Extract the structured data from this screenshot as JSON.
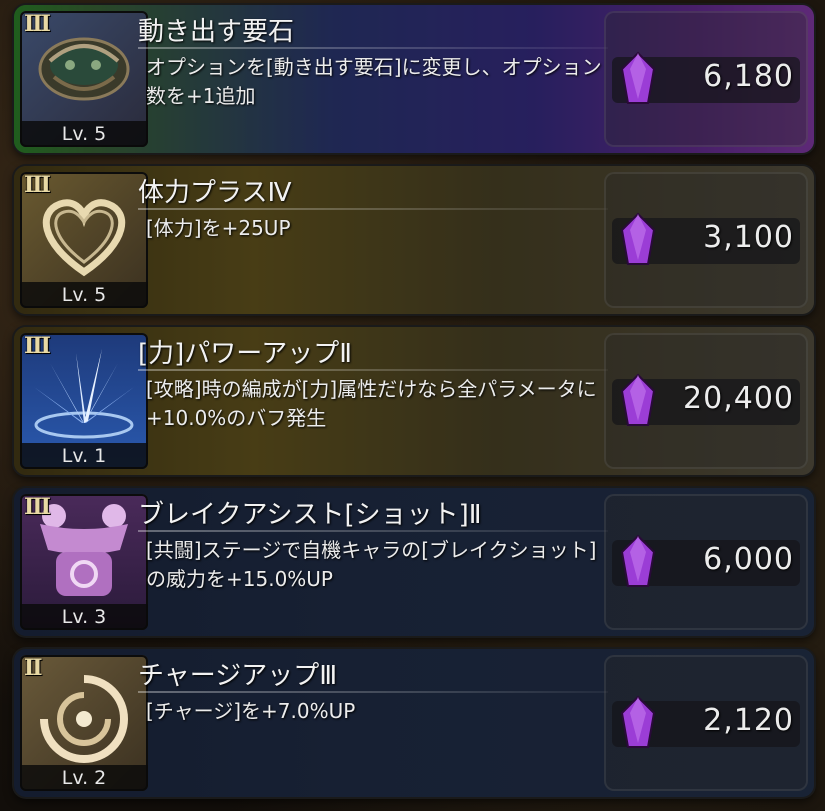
{
  "items": [
    {
      "rank": "III",
      "level": "Lv. 5",
      "title": "動き出す要石",
      "description": "オプションを[動き出す要石]に変更し、オプション数を+1追加",
      "price": "6,180",
      "icon": "keystone-icon"
    },
    {
      "rank": "III",
      "level": "Lv. 5",
      "title": "体力プラスⅣ",
      "description": "[体力]を+25UP",
      "price": "3,100",
      "icon": "heart-icon"
    },
    {
      "rank": "III",
      "level": "Lv. 1",
      "title": "[力]パワーアップⅡ",
      "description": "[攻略]時の編成が[力]属性だけなら全パラメータに+10.0%のバフ発生",
      "price": "20,400",
      "icon": "power-burst-icon"
    },
    {
      "rank": "III",
      "level": "Lv. 3",
      "title": "ブレイクアシスト[ショット]Ⅱ",
      "description": "[共闘]ステージで自機キャラの[ブレイクショット]の威力を+15.0%UP",
      "price": "6,000",
      "icon": "break-assist-icon"
    },
    {
      "rank": "II",
      "level": "Lv. 2",
      "title": "チャージアップⅢ",
      "description": "[チャージ]を+7.0%UP",
      "price": "2,120",
      "icon": "charge-swirl-icon"
    }
  ],
  "currency_icon": "purple-gem-icon",
  "colors": {
    "gem": "#9b3dd6",
    "rank_text": "#e8d9a4",
    "rarity_rainbow": "#6a2f9a",
    "rarity_gold": "#6a5a20",
    "rarity_blue": "#22304c"
  }
}
